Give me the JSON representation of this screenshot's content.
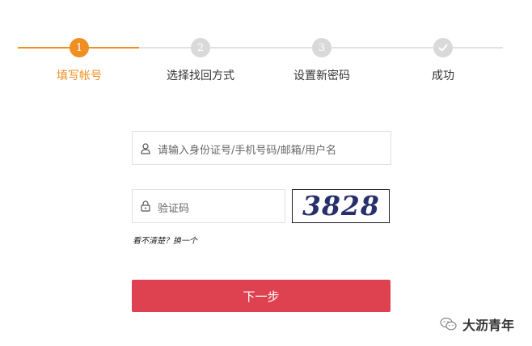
{
  "colors": {
    "active": "#ef8e21",
    "inactive": "#d9d9d9",
    "button": "#de4251"
  },
  "steps": [
    {
      "number": "1",
      "label": "填写帐号",
      "state": "active"
    },
    {
      "number": "2",
      "label": "选择找回方式",
      "state": "pending"
    },
    {
      "number": "3",
      "label": "设置新密码",
      "state": "pending"
    },
    {
      "number": "",
      "icon": "check-icon",
      "label": "成功",
      "state": "pending"
    }
  ],
  "account_input": {
    "placeholder": "请输入身份证号/手机号码/邮箱/用户名",
    "icon": "user-icon"
  },
  "code_input": {
    "placeholder": "验证码",
    "icon": "lock-icon"
  },
  "captcha": {
    "text": "3828"
  },
  "captcha_hint": "看不清楚？换一个",
  "next_button": "下一步",
  "watermark": {
    "icon": "wechat-icon",
    "text": "大沥青年"
  }
}
